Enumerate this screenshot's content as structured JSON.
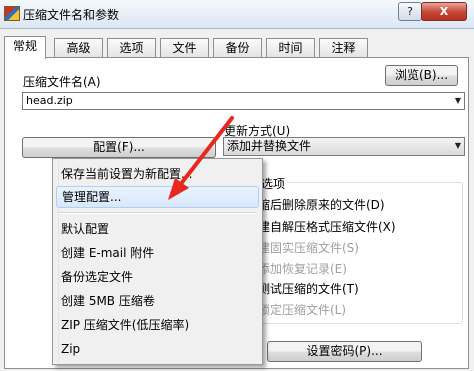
{
  "window": {
    "title": "压缩文件名和参数",
    "help_glyph": "?",
    "close_glyph": "X"
  },
  "tabs": [
    {
      "label": "常规"
    },
    {
      "label": "高级"
    },
    {
      "label": "选项"
    },
    {
      "label": "文件"
    },
    {
      "label": "备份"
    },
    {
      "label": "时间"
    },
    {
      "label": "注释"
    }
  ],
  "general": {
    "archive_name_label": "压缩文件名(A)",
    "browse_button": "浏览(B)...",
    "archive_name_value": "head.zip",
    "update_mode_label": "更新方式(U)",
    "update_mode_value": "添加并替换文件",
    "profiles_button": "配置(F)...",
    "set_password_button": "设置密码(P)...",
    "options_group_label": "选项",
    "options": [
      {
        "text": "缩后删除原来的文件(D)",
        "enabled": true
      },
      {
        "text": "建自解压格式压缩文件(X)",
        "enabled": true
      },
      {
        "text": "建固实压缩文件(S)",
        "enabled": false
      },
      {
        "text": "添加恢复记录(E)",
        "enabled": false
      },
      {
        "text": "测试压缩的文件(T)",
        "enabled": true
      },
      {
        "text": "锁定压缩文件(L)",
        "enabled": false
      }
    ]
  },
  "profiles_menu": {
    "items_top": [
      {
        "label": "保存当前设置为新配置..."
      },
      {
        "label": "管理配置...",
        "highlighted": true
      }
    ],
    "items_bottom": [
      {
        "label": "默认配置"
      },
      {
        "label": "创建 E-mail 附件"
      },
      {
        "label": "备份选定文件"
      },
      {
        "label": "创建 5MB 压缩卷"
      },
      {
        "label": "ZIP 压缩文件(低压缩率)"
      },
      {
        "label": "Zip"
      }
    ]
  },
  "colors": {
    "annotation_arrow": "#e8281e",
    "menu_highlight": "#d8e8fb"
  }
}
